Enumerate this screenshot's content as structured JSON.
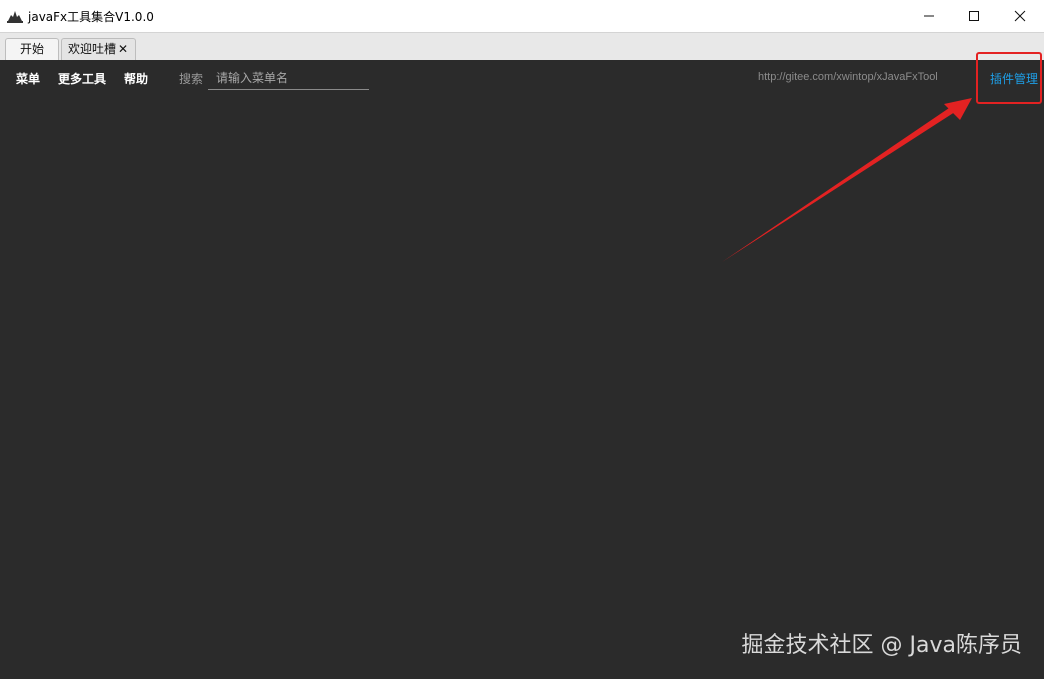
{
  "window": {
    "title": "javaFx工具集合V1.0.0",
    "controls": {
      "minimize": "—",
      "maximize": "☐",
      "close": "✕"
    }
  },
  "tabs": [
    {
      "label": "开始",
      "active": true
    },
    {
      "label": "欢迎吐槽",
      "close": "✕",
      "active": false
    }
  ],
  "menubar": {
    "items": [
      "菜单",
      "更多工具",
      "帮助"
    ],
    "search_label": "搜索",
    "search_placeholder": "请输入菜单名",
    "url": "http://gitee.com/xwintop/xJavaFxTool",
    "plugin_link": "插件管理"
  },
  "annotation": {
    "color": "#e32222"
  },
  "watermark": "掘金技术社区 @ Java陈序员",
  "colors": {
    "background": "#2b2b2b",
    "link": "#1e9fe8"
  }
}
